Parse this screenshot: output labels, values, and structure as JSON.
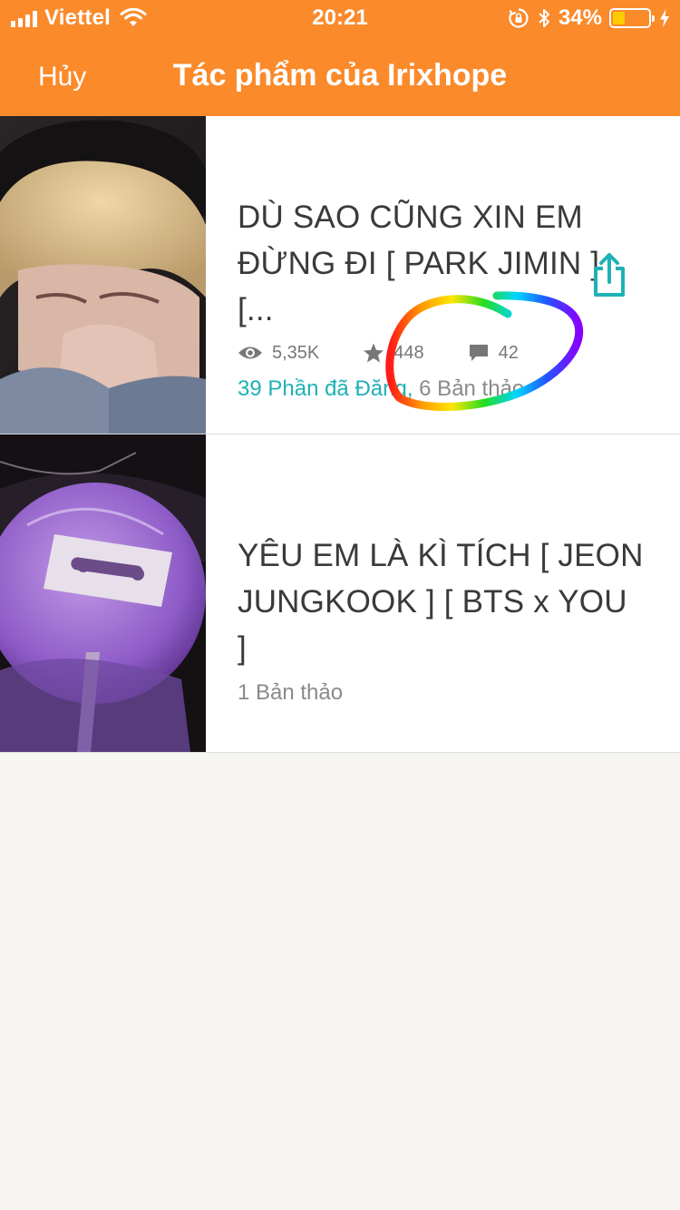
{
  "status_bar": {
    "carrier": "Viettel",
    "time": "20:21",
    "battery_percent": "34%",
    "battery_level": 0.34
  },
  "nav": {
    "cancel_label": "Hủy",
    "title": "Tác phẩm của Irixhope"
  },
  "stories": [
    {
      "title_line1": "DÙ SAO CŨNG XIN EM",
      "title_line2": "ĐỪNG ĐI [ PARK JIMIN ] [...",
      "views": "5,35K",
      "votes": "448",
      "comments": "42",
      "published_parts": "39 Phần đã Đăng,",
      "drafts": " 6 Bản thảo"
    },
    {
      "title_line1": "YÊU EM LÀ KÌ TÍCH [ JEON",
      "title_line2": "JUNGKOOK ] [ BTS x YOU ]",
      "drafts": "1 Bản thảo"
    }
  ],
  "colors": {
    "header": "#fb8a2b",
    "accent_teal": "#1fb1b6",
    "background": "#f6f5f2"
  }
}
